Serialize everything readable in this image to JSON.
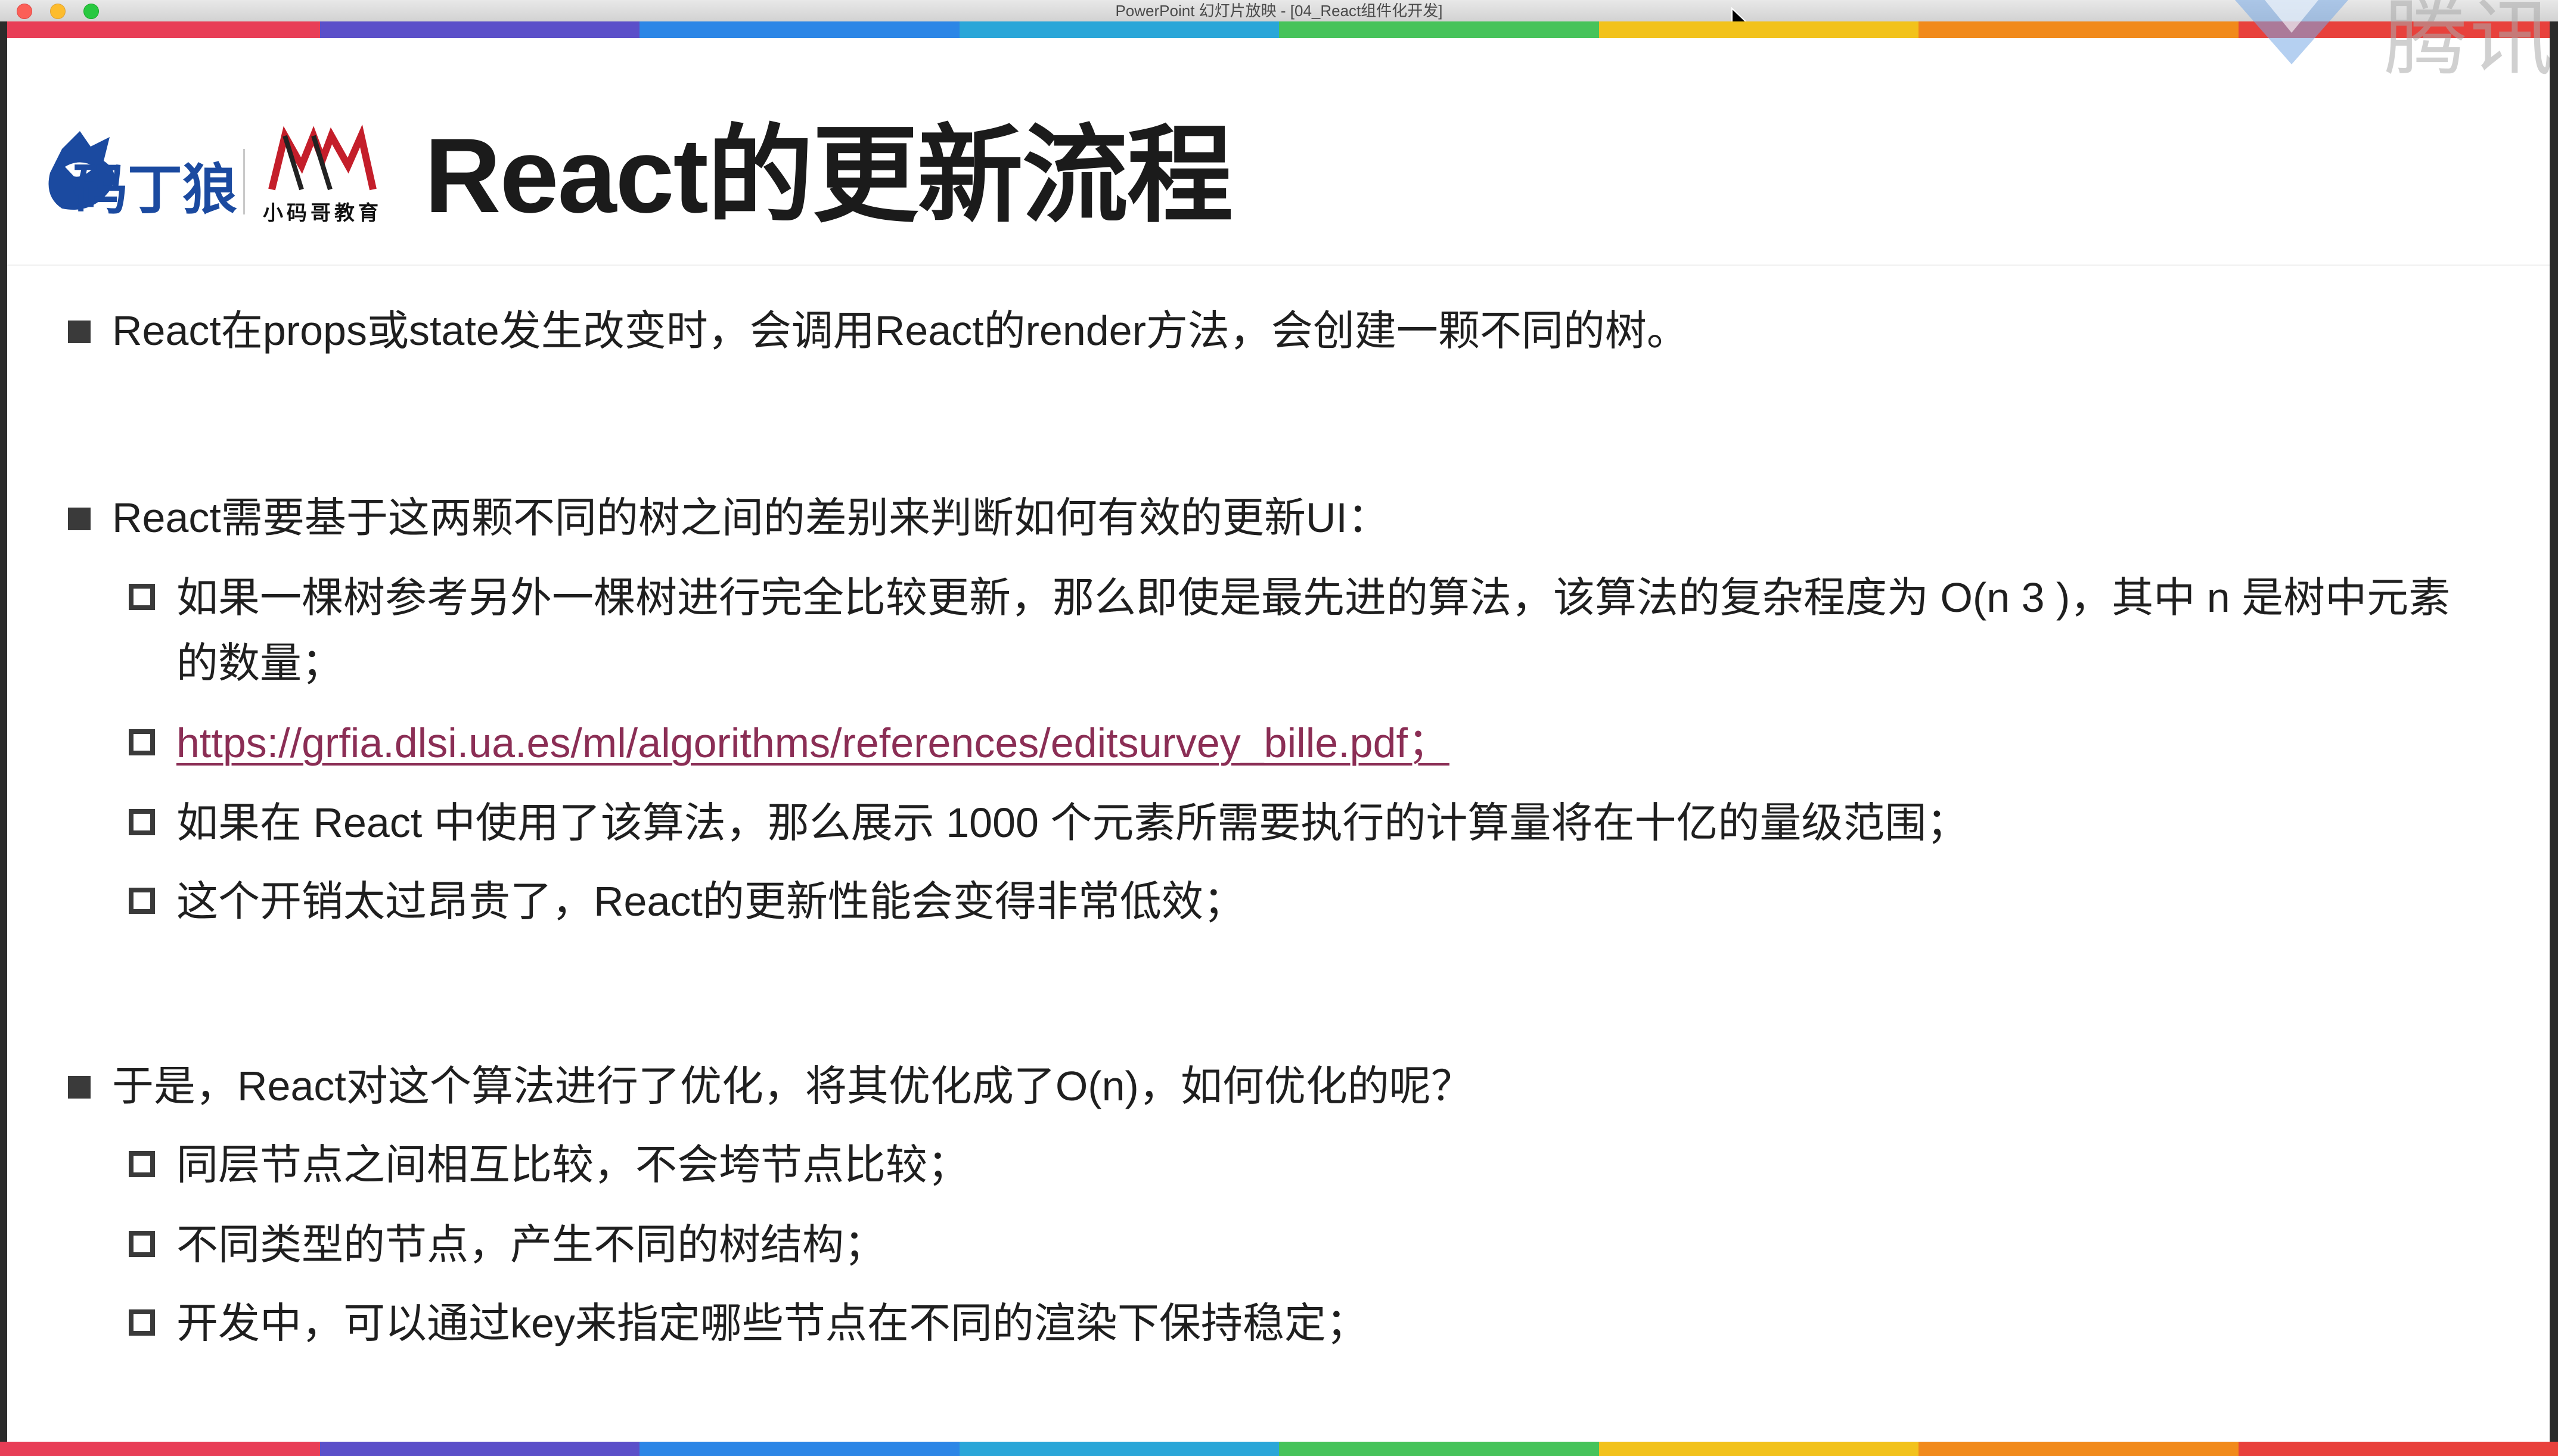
{
  "window": {
    "title": "PowerPoint 幻灯片放映 - [04_React组件化开发]"
  },
  "watermark": {
    "text": "腾讯"
  },
  "colors": {
    "rainbow": [
      "#e83e57",
      "#5b4fc9",
      "#2c86e6",
      "#2aa6d8",
      "#46c35a",
      "#f2c21b",
      "#f18a1b",
      "#e8413c"
    ],
    "title": "#1b1b1b",
    "link": "#8b2e55"
  },
  "header": {
    "logo_ding_text": "码丁狼",
    "logo_mm_caption": "小码哥教育",
    "title": "React的更新流程"
  },
  "bullets": [
    {
      "text": "React在props或state发生改变时，会调用React的render方法，会创建一颗不同的树。",
      "sub": []
    },
    {
      "text": "React需要基于这两颗不同的树之间的差别来判断如何有效的更新UI：",
      "sub": [
        {
          "text": "如果一棵树参考另外一棵树进行完全比较更新，那么即使是最先进的算法，该算法的复杂程度为 O(n 3 )，其中 n 是树中元素",
          "cont": "的数量；"
        },
        {
          "text": "https://grfia.dlsi.ua.es/ml/algorithms/references/editsurvey_bille.pdf；",
          "is_link": true
        },
        {
          "text": "如果在 React 中使用了该算法，那么展示 1000 个元素所需要执行的计算量将在十亿的量级范围；"
        },
        {
          "text": "这个开销太过昂贵了，React的更新性能会变得非常低效；"
        }
      ]
    },
    {
      "text": "于是，React对这个算法进行了优化，将其优化成了O(n)，如何优化的呢？",
      "sub": [
        {
          "text": "同层节点之间相互比较，不会垮节点比较；"
        },
        {
          "text": "不同类型的节点，产生不同的树结构；"
        },
        {
          "text": "开发中，可以通过key来指定哪些节点在不同的渲染下保持稳定；"
        }
      ]
    }
  ]
}
